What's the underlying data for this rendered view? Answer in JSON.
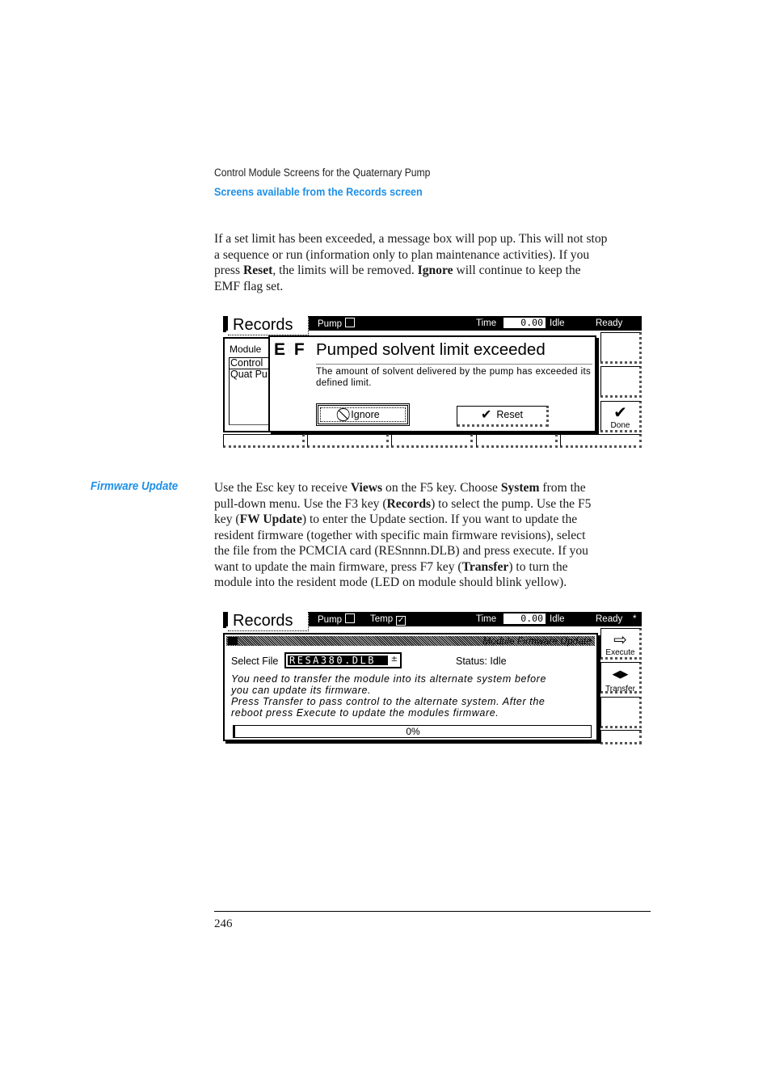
{
  "header": {
    "running_head": "Control Module Screens for the Quaternary Pump",
    "section_title": "Screens available from the Records screen"
  },
  "para1": {
    "lines": [
      [
        "If a set limit has been exceeded, a message box will pop up. This will not stop"
      ],
      [
        "a sequence or run (information only to plan maintenance activities). If you"
      ],
      [
        "press ",
        {
          "b": "Reset"
        },
        ", the limits will be removed. ",
        {
          "b": "Ignore"
        },
        " will continue to keep the"
      ],
      [
        "EMF flag set."
      ]
    ]
  },
  "screen1": {
    "tab_label": "Records",
    "status_bar": {
      "pump_label": "Pump",
      "pump_checked": false,
      "time_label": "Time",
      "time_value": "0.00",
      "state": "Idle",
      "ready": "Ready"
    },
    "module_panel": {
      "label": "Module",
      "items": [
        "Control",
        "Quat Pu"
      ]
    },
    "dialog": {
      "emf_icon": "EMF",
      "title": "Pumped solvent limit exceeded",
      "message": "The amount of solvent delivered by the pump has exceeded its defined limit.",
      "ignore_label": "Ignore",
      "ignore_icon": "prohibit-icon",
      "reset_label": "Reset",
      "reset_icon": "check-icon"
    },
    "softkeys": [
      {
        "label": "",
        "icon": ""
      },
      {
        "label": "",
        "icon": ""
      },
      {
        "label": "Done",
        "icon": "check-icon",
        "glyph": "✔"
      }
    ],
    "fkeys": [
      "",
      "",
      "",
      "",
      ""
    ]
  },
  "side_heading": "Firmware Update",
  "para2": {
    "lines": [
      [
        "Use the Esc key to receive ",
        {
          "b": "Views"
        },
        " on the F5 key. Choose ",
        {
          "b": "System"
        },
        " from the"
      ],
      [
        "pull-down menu. Use the F3 key (",
        {
          "b": "Records"
        },
        ") to select the pump. Use the F5"
      ],
      [
        "key (",
        {
          "b": "FW Update"
        },
        ") to enter the Update section. If you want to update the"
      ],
      [
        "resident firmware (together with specific main firmware revisions), select"
      ],
      [
        "the file from the PCMCIA card (RESnnnn.DLB) and press execute. If you"
      ],
      [
        "want to update the main firmware, press F7 key (",
        {
          "b": "Transfer"
        },
        ") to turn the"
      ],
      [
        "module into the resident mode (LED on module should blink yellow)."
      ]
    ]
  },
  "screen2": {
    "tab_label": "Records",
    "status_bar": {
      "pump_label": "Pump",
      "pump_checked": false,
      "temp_label": "Temp",
      "temp_checked": true,
      "time_label": "Time",
      "time_value": "0.00",
      "state": "Idle",
      "ready": "Ready",
      "flag": "*"
    },
    "panel": {
      "title": "Module Firmware Update",
      "select_label": "Select File",
      "select_value": "RESA380.DLB",
      "status_text": "Status: Idle",
      "message_lines": [
        "You need to transfer the module into its alternate system before",
        "you can update its firmware.",
        "Press Transfer to pass control to the alternate system. After the",
        "reboot press Execute to update the modules firmware."
      ],
      "progress_percent": 0,
      "progress_label": "0%"
    },
    "softkeys": [
      {
        "label": "Execute",
        "icon": "arrow-right-icon",
        "glyph": "⇨"
      },
      {
        "label": "Transfer",
        "icon": "transfer-icon",
        "glyph": "◀▶"
      },
      {
        "label": "",
        "icon": ""
      },
      {
        "label": "",
        "icon": ""
      }
    ]
  },
  "footer": {
    "page_number": "246"
  }
}
